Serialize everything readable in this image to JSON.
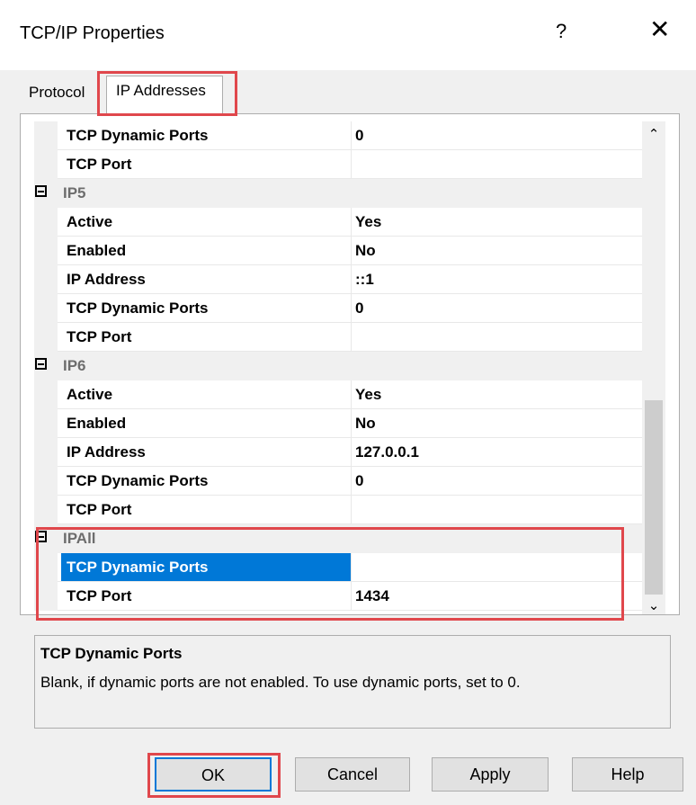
{
  "window": {
    "title": "TCP/IP Properties",
    "help_glyph": "?",
    "close_glyph": "✕"
  },
  "tabs": [
    {
      "label": "Protocol"
    },
    {
      "label": "IP Addresses"
    }
  ],
  "grid": {
    "rows": [
      {
        "kind": "prop",
        "name": "TCP Dynamic Ports",
        "value": "0"
      },
      {
        "kind": "prop",
        "name": "TCP Port",
        "value": ""
      },
      {
        "kind": "group",
        "name": "IP5"
      },
      {
        "kind": "prop",
        "name": "Active",
        "value": "Yes"
      },
      {
        "kind": "prop",
        "name": "Enabled",
        "value": "No"
      },
      {
        "kind": "prop",
        "name": "IP Address",
        "value": "::1"
      },
      {
        "kind": "prop",
        "name": "TCP Dynamic Ports",
        "value": "0"
      },
      {
        "kind": "prop",
        "name": "TCP Port",
        "value": ""
      },
      {
        "kind": "group",
        "name": "IP6"
      },
      {
        "kind": "prop",
        "name": "Active",
        "value": "Yes"
      },
      {
        "kind": "prop",
        "name": "Enabled",
        "value": "No"
      },
      {
        "kind": "prop",
        "name": "IP Address",
        "value": "127.0.0.1"
      },
      {
        "kind": "prop",
        "name": "TCP Dynamic Ports",
        "value": "0"
      },
      {
        "kind": "prop",
        "name": "TCP Port",
        "value": ""
      },
      {
        "kind": "group",
        "name": "IPAll"
      },
      {
        "kind": "prop",
        "name": "TCP Dynamic Ports",
        "value": "",
        "selected": true
      },
      {
        "kind": "prop",
        "name": "TCP Port",
        "value": "1434"
      }
    ]
  },
  "scrollbar": {
    "up_glyph": "⌃",
    "down_glyph": "⌄"
  },
  "description": {
    "title": "TCP Dynamic Ports",
    "text": "Blank, if dynamic ports are not enabled. To use dynamic ports, set to 0."
  },
  "buttons": {
    "ok": "OK",
    "cancel": "Cancel",
    "apply": "Apply",
    "help": "Help"
  },
  "colors": {
    "selection": "#0078d7",
    "highlight_box": "#e0474c"
  }
}
